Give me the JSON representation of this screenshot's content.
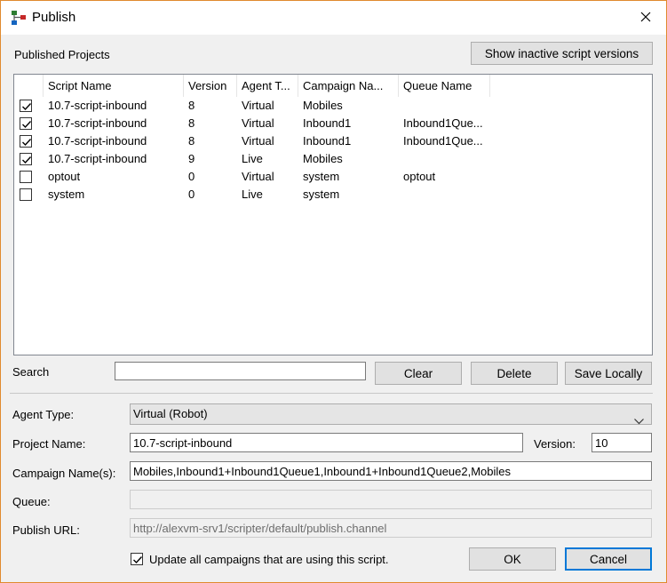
{
  "window": {
    "title": "Publish"
  },
  "published": {
    "title": "Published Projects",
    "show_inactive_label": "Show inactive script versions",
    "columns": [
      "Script Name",
      "Version",
      "Agent T...",
      "Campaign Na...",
      "Queue Name"
    ],
    "rows": [
      {
        "checked": true,
        "script": "10.7-script-inbound",
        "version": "8",
        "agent": "Virtual",
        "campaign": "Mobiles",
        "queue": ""
      },
      {
        "checked": true,
        "script": "10.7-script-inbound",
        "version": "8",
        "agent": "Virtual",
        "campaign": "Inbound1",
        "queue": "Inbound1Que..."
      },
      {
        "checked": true,
        "script": "10.7-script-inbound",
        "version": "8",
        "agent": "Virtual",
        "campaign": "Inbound1",
        "queue": "Inbound1Que..."
      },
      {
        "checked": true,
        "script": "10.7-script-inbound",
        "version": "9",
        "agent": "Live",
        "campaign": "Mobiles",
        "queue": ""
      },
      {
        "checked": false,
        "script": "optout",
        "version": "0",
        "agent": "Virtual",
        "campaign": "system",
        "queue": "optout"
      },
      {
        "checked": false,
        "script": "system",
        "version": "0",
        "agent": "Live",
        "campaign": "system",
        "queue": ""
      }
    ]
  },
  "search": {
    "label": "Search",
    "value": "",
    "clear_label": "Clear",
    "delete_label": "Delete",
    "save_locally_label": "Save Locally"
  },
  "form": {
    "agent_type_label": "Agent Type:",
    "agent_type_value": "Virtual (Robot)",
    "project_name_label": "Project Name:",
    "project_name_value": "10.7-script-inbound",
    "version_label": "Version:",
    "version_value": "10",
    "campaign_label": "Campaign Name(s):",
    "campaign_value": "Mobiles,Inbound1+Inbound1Queue1,Inbound1+Inbound1Queue2,Mobiles",
    "queue_label": "Queue:",
    "queue_value": "",
    "publish_url_label": "Publish URL:",
    "publish_url_value": "http://alexvm-srv1/scripter/default/publish.channel",
    "update_all_label": "Update all campaigns that are using this script.",
    "update_all_checked": true
  },
  "footer": {
    "ok_label": "OK",
    "cancel_label": "Cancel"
  },
  "colors": {
    "accent": "#0078d7",
    "window_border": "#e08a2e"
  }
}
